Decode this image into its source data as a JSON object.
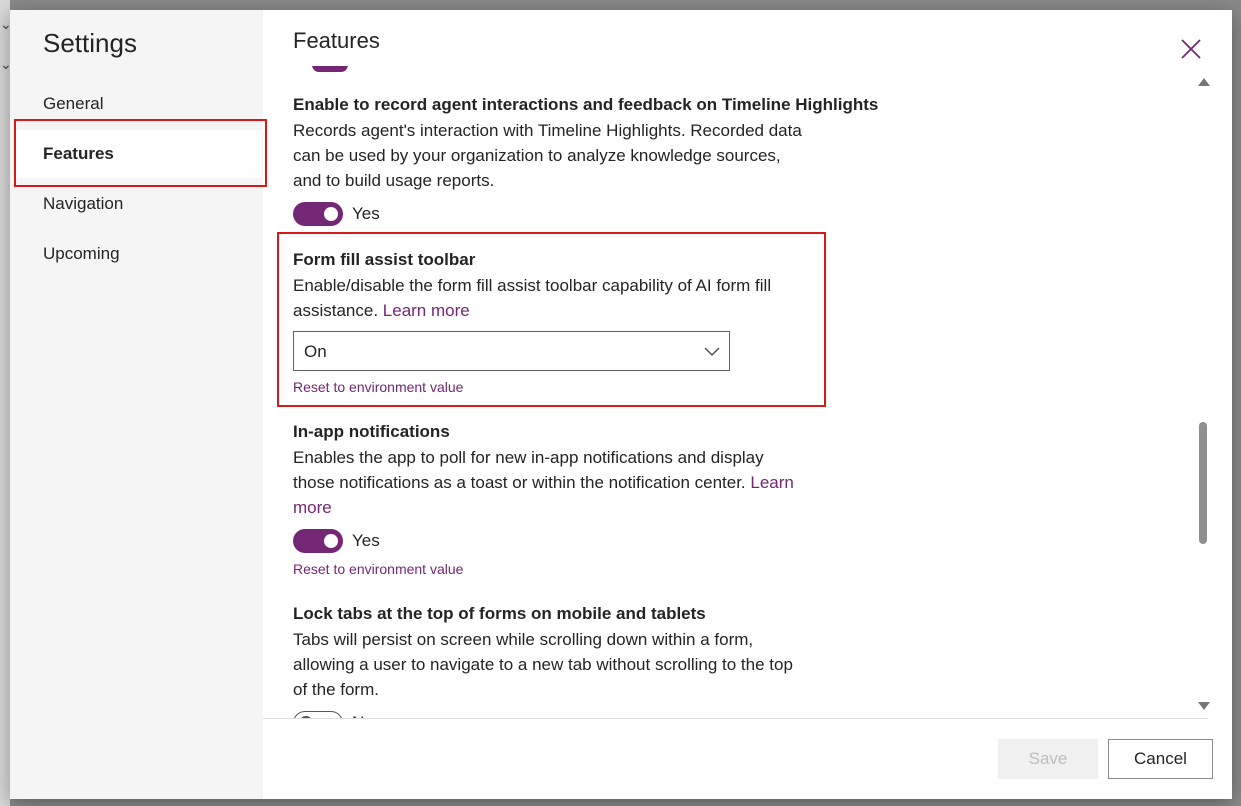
{
  "sidebar": {
    "title": "Settings",
    "items": [
      {
        "label": "General"
      },
      {
        "label": "Features"
      },
      {
        "label": "Navigation"
      },
      {
        "label": "Upcoming"
      }
    ],
    "active_item": "Features"
  },
  "main": {
    "title": "Features",
    "settings": [
      {
        "title": "Enable to record agent interactions and feedback on Timeline Highlights",
        "description": "Records agent's interaction with Timeline Highlights. Recorded data can be used by your organization to analyze knowledge sources, and to build usage reports.",
        "toggle_on": true,
        "toggle_label": "Yes"
      },
      {
        "title": "Form fill assist toolbar",
        "description": "Enable/disable the form fill assist toolbar capability of AI form fill assistance.",
        "link": "Learn more",
        "select_value": "On",
        "reset_label": "Reset to environment value"
      },
      {
        "title": "In-app notifications",
        "description": "Enables the app to poll for new in-app notifications and display those notifications as a toast or within the notification center.",
        "link": "Learn more",
        "toggle_on": true,
        "toggle_label": "Yes",
        "reset_label": "Reset to environment value"
      },
      {
        "title": "Lock tabs at the top of forms on mobile and tablets",
        "description": "Tabs will persist on screen while scrolling down within a form, allowing a user to navigate to a new tab without scrolling to the top of the form.",
        "toggle_on": false,
        "toggle_label": "No"
      }
    ]
  },
  "footer": {
    "save_label": "Save",
    "cancel_label": "Cancel"
  },
  "colors": {
    "accent": "#742774",
    "highlight_box": "#d7191c"
  },
  "icons": {
    "close": "close-icon",
    "dropdown": "chevron-down-icon"
  }
}
